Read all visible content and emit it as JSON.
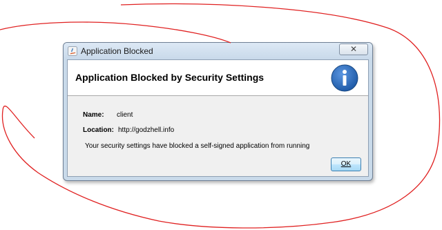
{
  "window": {
    "title": "Application Blocked",
    "close_label": "✕"
  },
  "header": {
    "title": "Application Blocked by Security Settings"
  },
  "details": {
    "name_label": "Name:",
    "name_value": "client",
    "location_label": "Location:",
    "location_value": "http://godzhell.info"
  },
  "message": "Your security settings have blocked a self-signed application from running",
  "buttons": {
    "ok_label": "OK"
  },
  "colors": {
    "annotation_stroke": "#e02020",
    "info_icon_blue": "#1f5ba8",
    "dialog_frame": "#c9daea"
  }
}
